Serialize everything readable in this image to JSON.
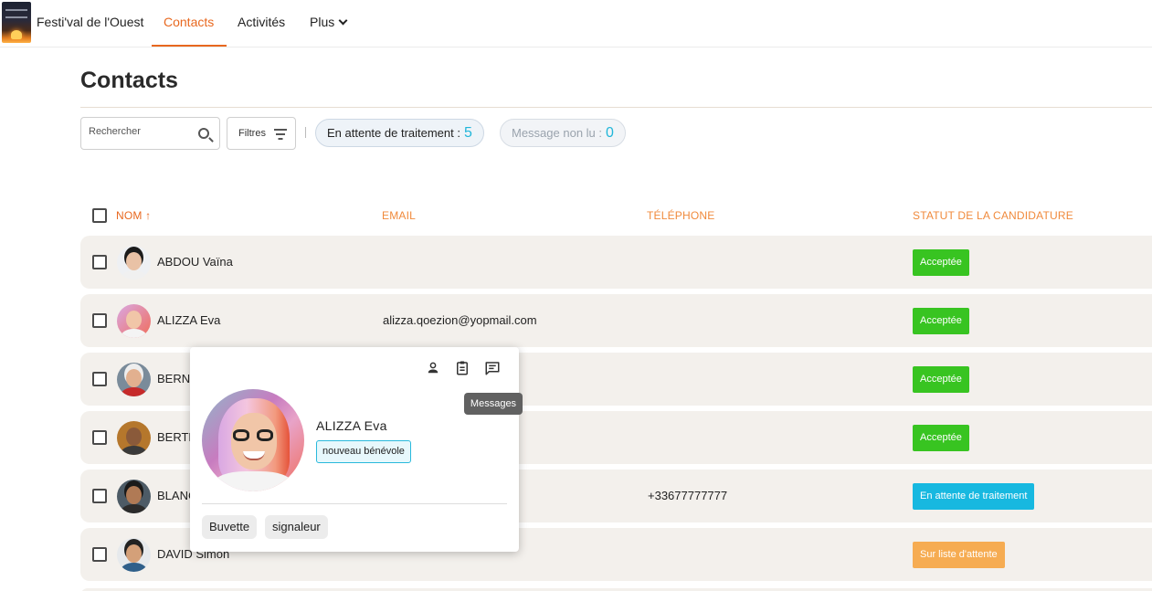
{
  "app": {
    "title": "Festi'val de l'Ouest"
  },
  "nav": {
    "contacts": "Contacts",
    "activites": "Activités",
    "plus": "Plus"
  },
  "page": {
    "title": "Contacts"
  },
  "toolbar": {
    "search_placeholder": "Rechercher",
    "filters_label": "Filtres",
    "pending_label": "En attente de traitement :",
    "pending_count": "5",
    "unread_label": "Message non lu :",
    "unread_count": "0"
  },
  "table": {
    "headers": {
      "nom": "NOM",
      "email": "EMAIL",
      "telephone": "TÉLÉPHONE",
      "statut": "STATUT DE LA CANDIDATURE"
    },
    "rows": [
      {
        "name": "ABDOU Vaïna",
        "email": "",
        "phone": "",
        "status": "Acceptée"
      },
      {
        "name": "ALIZZA Eva",
        "email": "alizza.qoezion@yopmail.com",
        "phone": "",
        "status": "Acceptée"
      },
      {
        "name": "BERNA",
        "email": "",
        "phone": "",
        "status": "Acceptée"
      },
      {
        "name": "BERTR",
        "email": "",
        "phone": "",
        "status": "Acceptée"
      },
      {
        "name": "BLANC",
        "email": "",
        "phone": "+33677777777",
        "status": "En attente de traitement"
      },
      {
        "name": "DAVID Simon",
        "email": "",
        "phone": "",
        "status": "Sur liste d'attente"
      }
    ]
  },
  "popover": {
    "name": "ALIZZA Eva",
    "badge": "nouveau bénévole",
    "tags": [
      "Buvette",
      "signaleur"
    ],
    "tooltip": "Messages"
  },
  "colors": {
    "accent": "#e8681f",
    "accepted": "#38c421",
    "pending": "#17b8e0",
    "waitlist": "#f6ac52"
  }
}
